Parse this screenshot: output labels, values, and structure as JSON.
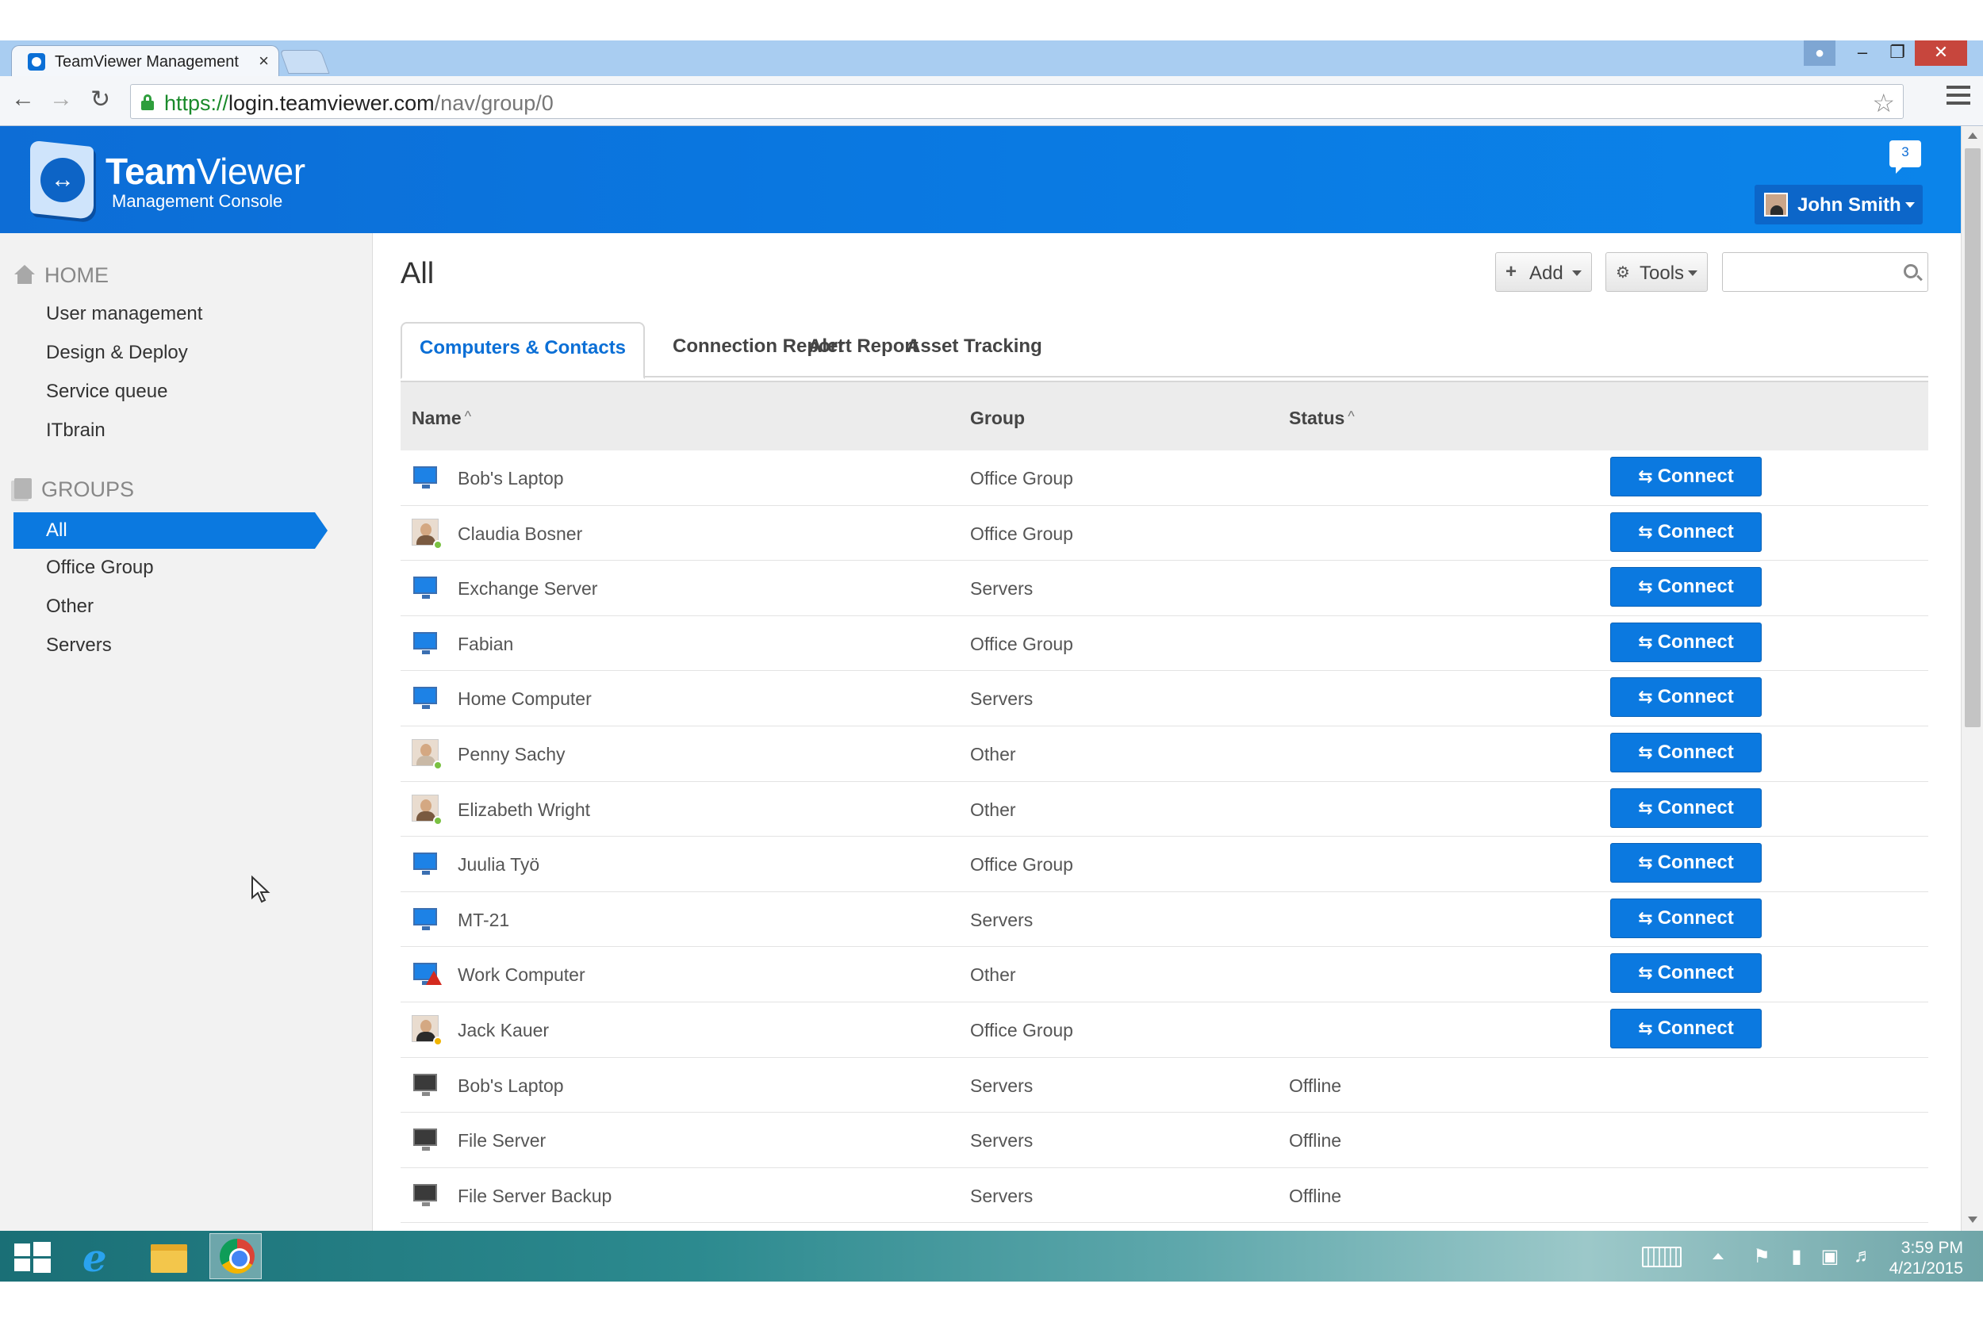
{
  "browser": {
    "tab_title": "TeamViewer Management",
    "tab_close": "×",
    "url_scheme": "https://",
    "url_host": "login.teamviewer.com",
    "url_path": "/nav/group/0"
  },
  "header": {
    "logo_team": "Team",
    "logo_viewer": "Viewer",
    "logo_subtitle": "Management Console",
    "notification_count": "3",
    "user_name": "John Smith"
  },
  "sidebar": {
    "home_label": "HOME",
    "home_links": [
      "User management",
      "Design & Deploy",
      "Service queue",
      "ITbrain"
    ],
    "groups_label": "GROUPS",
    "group_links": [
      "All",
      "Office Group",
      "Other",
      "Servers"
    ],
    "active_group": "All"
  },
  "main": {
    "title": "All",
    "add_label": "Add",
    "tools_label": "Tools",
    "search_placeholder": "",
    "tabs": [
      "Computers & Contacts",
      "Connection Report",
      "Alert Report",
      "Asset Tracking"
    ],
    "active_tab": "Computers & Contacts",
    "columns": {
      "name": "Name",
      "group": "Group",
      "status": "Status",
      "sort_indicator": "^"
    },
    "connect_label": "Connect",
    "rows": [
      {
        "name": "Bob's Laptop",
        "group": "Office Group",
        "status": "",
        "icon": "computer-online-icon",
        "connect": true
      },
      {
        "name": "Claudia Bosner",
        "group": "Office Group",
        "status": "",
        "icon": "contact-photo-online-icon",
        "connect": true
      },
      {
        "name": "Exchange Server",
        "group": "Servers",
        "status": "",
        "icon": "computer-online-icon",
        "connect": true
      },
      {
        "name": "Fabian",
        "group": "Office Group",
        "status": "",
        "icon": "computer-online-icon",
        "connect": true
      },
      {
        "name": "Home Computer",
        "group": "Servers",
        "status": "",
        "icon": "computer-online-icon",
        "connect": true
      },
      {
        "name": "Penny Sachy",
        "group": "Other",
        "status": "",
        "icon": "contact-photo-online-icon",
        "connect": true
      },
      {
        "name": "Elizabeth Wright",
        "group": "Other",
        "status": "",
        "icon": "contact-photo-online-icon",
        "connect": true
      },
      {
        "name": "Juulia Työ",
        "group": "Office Group",
        "status": "",
        "icon": "computer-online-icon",
        "connect": true
      },
      {
        "name": "MT-21",
        "group": "Servers",
        "status": "",
        "icon": "computer-online-icon",
        "connect": true
      },
      {
        "name": "Work Computer",
        "group": "Other",
        "status": "",
        "icon": "computer-warning-icon",
        "connect": true
      },
      {
        "name": "Jack Kauer",
        "group": "Office Group",
        "status": "",
        "icon": "contact-photo-away-icon",
        "connect": true
      },
      {
        "name": "Bob's Laptop",
        "group": "Servers",
        "status": "Offline",
        "icon": "computer-offline-icon",
        "connect": false
      },
      {
        "name": "File Server",
        "group": "Servers",
        "status": "Offline",
        "icon": "computer-offline-icon",
        "connect": false
      },
      {
        "name": "File Server Backup",
        "group": "Servers",
        "status": "Offline",
        "icon": "computer-offline-icon",
        "connect": false
      }
    ]
  },
  "taskbar": {
    "time": "3:59 PM",
    "date": "4/21/2015"
  },
  "colors": {
    "brand_blue": "#0b79e0",
    "header_blue": "#0d6dd6",
    "online_green": "#7ac142",
    "away_yellow": "#f0b400",
    "warning_red": "#d42a1f"
  }
}
